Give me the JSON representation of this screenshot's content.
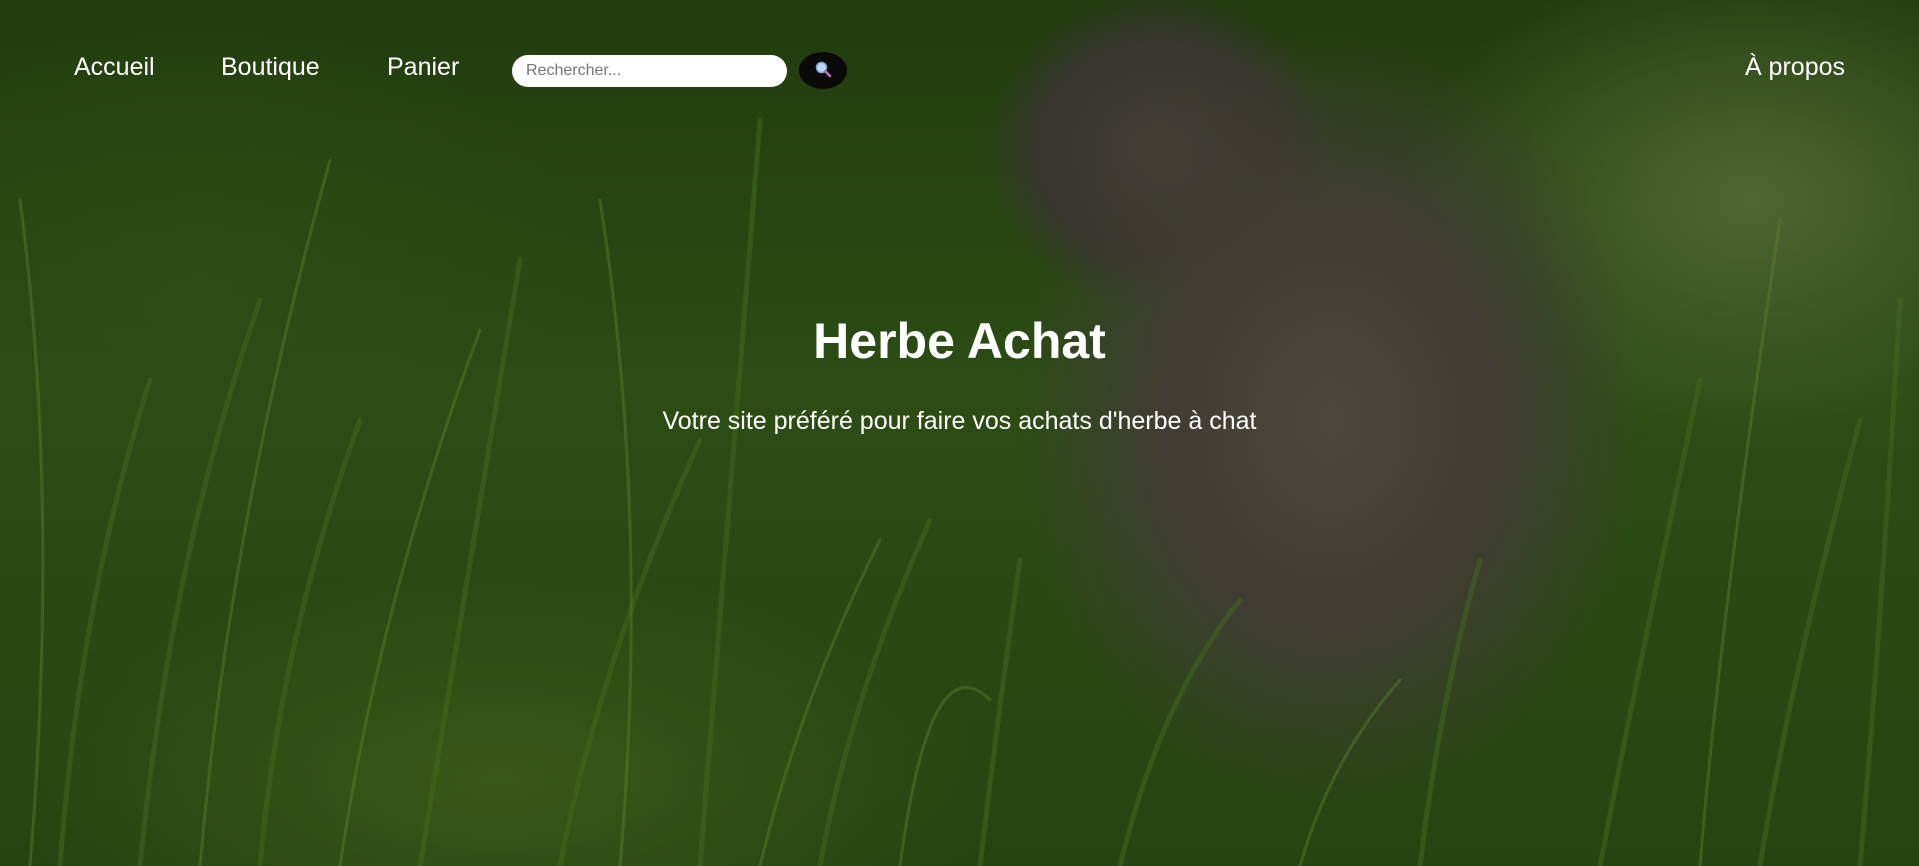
{
  "nav": {
    "links": [
      {
        "label": "Accueil"
      },
      {
        "label": "Boutique"
      },
      {
        "label": "Panier"
      }
    ],
    "about_label": "À propos",
    "search": {
      "placeholder": "Rechercher...",
      "value": "",
      "button_icon": "search-icon"
    }
  },
  "hero": {
    "title": "Herbe Achat",
    "subtitle": "Votre site préféré pour faire vos achats d'herbe à chat",
    "background": "cat-in-grass-photo"
  },
  "colors": {
    "text": "#ffffff",
    "search_button_bg": "#0a0a0a",
    "search_input_bg": "#ffffff"
  }
}
